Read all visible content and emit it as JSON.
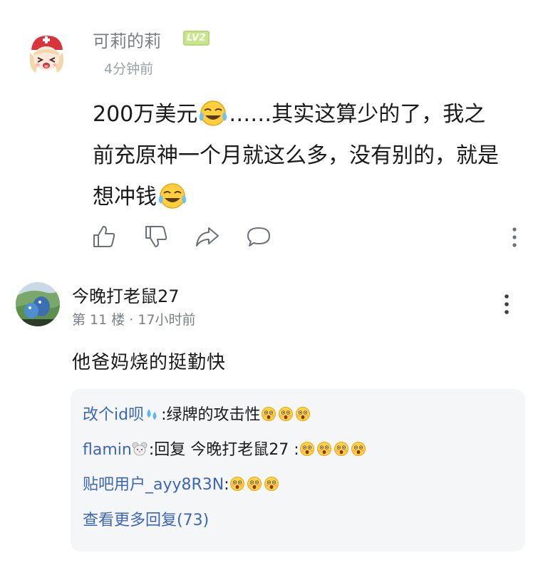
{
  "comment1": {
    "username": "可莉的莉",
    "level_badge": "LV2",
    "time": "4分钟前",
    "text": {
      "line1_a": "200万美元",
      "line1_b": "……其实这算少的了，我之",
      "line2": "前充原神一个月就这么多，没有别的，就是",
      "line3": "想冲钱"
    },
    "actions": [
      "like-icon",
      "dislike-icon",
      "share-icon",
      "reply-icon",
      "more-icon"
    ]
  },
  "comment2": {
    "username": "今晚打老鼠27",
    "meta": "第 11 楼 · 17小时前",
    "text": "他爸妈烧的挺勤快",
    "replies": [
      {
        "user": "改个id呗",
        "text": ":绿牌的攻击性",
        "emoji_count": 3
      },
      {
        "user": "flamin",
        "text": ":回复  今晚打老鼠27 :",
        "emoji_count": 4
      },
      {
        "user": "贴吧用户_ayy8R3N",
        "text": ":",
        "emoji_count": 3
      }
    ],
    "more_replies": "查看更多回复(73)"
  },
  "colors": {
    "link": "#3c66b8",
    "muted": "#7a7f87",
    "level_badge": "#c8e68c",
    "reply_bg": "#f5f6f8"
  }
}
